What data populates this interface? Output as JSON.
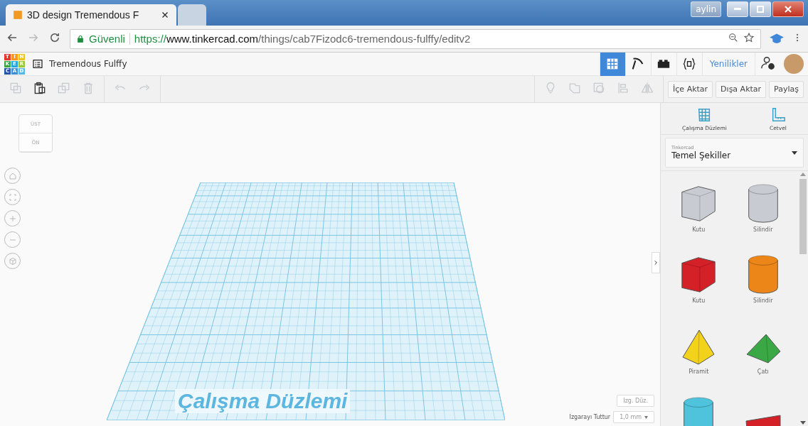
{
  "browser": {
    "tabs": [
      {
        "title": "3D design Tremendous F",
        "selected": true
      },
      {
        "selected": false
      }
    ],
    "user": "aylin",
    "secure_label": "Güvenli",
    "url": {
      "scheme": "https://",
      "host": "www.tinkercad.com",
      "path": "/things/cab7Fizodc6-tremendous-fulffy/editv2"
    }
  },
  "app": {
    "logo": [
      "T",
      "I",
      "N",
      "K",
      "E",
      "R",
      "C",
      "A",
      "D"
    ],
    "design_title": "Tremendous Fulffy",
    "modes": [
      {
        "kind": "grid",
        "selected": true
      },
      {
        "kind": "pickaxe",
        "selected": false
      },
      {
        "kind": "bricks",
        "selected": false
      },
      {
        "kind": "code",
        "selected": false
      }
    ],
    "news": "Yenilikler"
  },
  "toolbar": {
    "left": [
      {
        "kind": "copy",
        "disabled": true
      },
      {
        "kind": "paste",
        "disabled": false
      },
      {
        "kind": "duplicate",
        "disabled": true
      },
      {
        "kind": "delete",
        "disabled": true
      },
      {
        "kind": "undo",
        "disabled": true
      },
      {
        "kind": "redo",
        "disabled": true
      }
    ],
    "right": [
      {
        "kind": "bulb",
        "disabled": true
      },
      {
        "kind": "group",
        "disabled": true
      },
      {
        "kind": "ungroup",
        "disabled": true
      },
      {
        "kind": "align",
        "disabled": true
      },
      {
        "kind": "mirror",
        "disabled": true
      }
    ],
    "buttons": [
      "İçe Aktar",
      "Dışa Aktar",
      "Paylaş"
    ]
  },
  "viewcube": {
    "top": "ÜST",
    "front": "ÖN"
  },
  "workplane": {
    "label": "Çalışma Düzlemi",
    "edit_grid": "Izg. Düz.",
    "snap_label": "Izgarayı Tuttur",
    "snap_value": "1,0 mm"
  },
  "panel": {
    "tools": [
      {
        "kind": "workplane",
        "label": "Çalışma Düzlemi"
      },
      {
        "kind": "ruler",
        "label": "Cetvel"
      }
    ],
    "library": {
      "caption": "Tinkercad",
      "value": "Temel Şekiller"
    },
    "shapes": [
      {
        "kind": "box",
        "color": "#c8ccd2",
        "label": "Kutu"
      },
      {
        "kind": "cylinder",
        "color": "#c8ccd2",
        "label": "Silindir"
      },
      {
        "kind": "box",
        "color": "#d42027",
        "label": "Kutu"
      },
      {
        "kind": "cylinder",
        "color": "#ec8618",
        "label": "Silindir"
      },
      {
        "kind": "pyramid",
        "color": "#f2d21a",
        "label": "Piramit"
      },
      {
        "kind": "roof",
        "color": "#3aa845",
        "label": "Çatı"
      },
      {
        "kind": "cylinder",
        "color": "#4fc3dc"
      },
      {
        "kind": "text",
        "color": "#d42027"
      }
    ]
  }
}
